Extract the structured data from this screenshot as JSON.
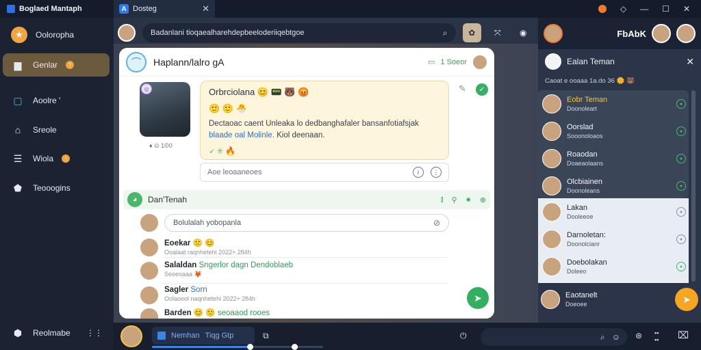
{
  "window": {
    "app_name": "Boglaed Mantaph",
    "tab_label": "Dosteg",
    "tab_icon": "A",
    "controls": [
      "—",
      "☐",
      "✕"
    ]
  },
  "sidebar": {
    "items": [
      {
        "label": "Ooloropha"
      },
      {
        "label": "Genlar"
      },
      {
        "label": "Aoolre '"
      },
      {
        "label": "Sreole"
      },
      {
        "label": "Wiola"
      },
      {
        "label": "Teooogins"
      }
    ],
    "bottom_label": "Reolmabe"
  },
  "search": {
    "placeholder": "Badanlani tioqaealharehdepbeeloderiiqebtgoe"
  },
  "card": {
    "title": "Haplann/lalro gA",
    "head_status": "1 Soeor",
    "photo_meta": "♦ ⊙ 1©0",
    "post": {
      "title": "Orbrciolana",
      "title_emoji": "😊 📟 🐻 😡",
      "emoji_row": "🙂 🙂 🐣",
      "text_line1": "Dectaoac caent Unleaka lo dedbanghafaler bansanfotiafsjak",
      "text_line2_blue": "blaade oal Molinle.",
      "text_line2_rest": " Kiol deenaan.",
      "reactions": "🗸 ✳ 🔥"
    },
    "reply_placeholder": "Aoe   leoaaneoes",
    "thread_title": "Dan'Tenah",
    "comment_placeholder": "Bolulalah yobopanla",
    "comments": [
      {
        "name": "Eoekar",
        "emoji": "🙁 😊",
        "meta": "Ooalaat raqnhetehi  2022+ 2fl4h",
        "extra": ""
      },
      {
        "name": "Salaldan",
        "emoji": "",
        "tag": "Sngerlor dagn Dendoblaeb",
        "meta": "Seoeoaaa 🦊",
        "extra": ""
      },
      {
        "name": "Sagler",
        "tag": "Sorn",
        "meta": "Oolaoool naqnhetehi  2022+ 2fl4h",
        "extra": ""
      },
      {
        "name": "Barden",
        "emoji": "😊 🙁",
        "tag": "seoaaod rooes",
        "meta": "",
        "extra": ""
      }
    ]
  },
  "right_panel": {
    "brand": "FbAbK",
    "title": "Ealan Teman",
    "subtitle": "Caoat e ooaaa 1a.do 36 🌼 🐻",
    "contacts_dark": [
      {
        "name": "Eobr Teman",
        "meta": "Doonoleart"
      },
      {
        "name": "Oorslad",
        "meta": "Sooonoloaos"
      },
      {
        "name": "Roaodan",
        "meta": "Doaeaolaans"
      },
      {
        "name": "Olcbiainen",
        "meta": "Doonoleans"
      }
    ],
    "contacts_light": [
      {
        "name": "Lakan",
        "meta": "Dooleeoe"
      },
      {
        "name": "Darnoletan:",
        "meta": "Doonolcianr"
      },
      {
        "name": "Doebolakan",
        "meta": "Doleeo"
      }
    ],
    "bottom_contact": {
      "name": "Eaotanelt",
      "meta": "Doeoee"
    }
  },
  "bottombar": {
    "segment_label": "Nemhan",
    "segment_extra": "Tiqg  Gtp",
    "progress": 0.57,
    "progress_secondary": 0.58
  },
  "colors": {
    "accent": "#3a86e6",
    "green": "#33b05f",
    "sidebar_active": "#6b5a3e",
    "orange": "#f5a623"
  }
}
